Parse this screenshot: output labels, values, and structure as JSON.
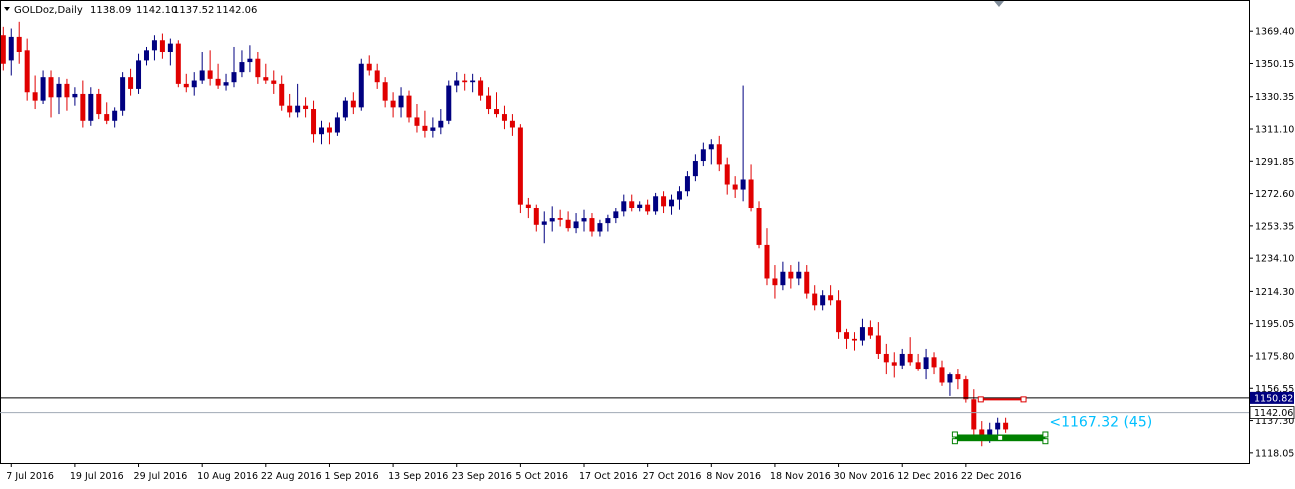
{
  "chart_data": {
    "type": "candlestick",
    "title": "GOLDoz,Daily",
    "ohlc_readout": [
      "1138.09",
      "1142.10",
      "1137.52",
      "1142.06"
    ],
    "ylim": [
      1112,
      1388
    ],
    "y_ticks": [
      "1369.40",
      "1350.15",
      "1330.35",
      "1311.10",
      "1291.85",
      "1272.60",
      "1253.35",
      "1234.10",
      "1214.30",
      "1195.05",
      "1175.80",
      "1156.55",
      "1137.30",
      "1118.05"
    ],
    "x_labels": [
      "7 Jul 2016",
      "19 Jul 2016",
      "29 Jul 2016",
      "10 Aug 2016",
      "22 Aug 2016",
      "1 Sep 2016",
      "13 Sep 2016",
      "23 Sep 2016",
      "5 Oct 2016",
      "17 Oct 2016",
      "27 Oct 2016",
      "8 Nov 2016",
      "18 Nov 2016",
      "30 Nov 2016",
      "12 Dec 2016",
      "22 Dec 2016"
    ],
    "x_label_bar_index": [
      1,
      9,
      17,
      25,
      33,
      41,
      49,
      57,
      65,
      73,
      81,
      89,
      97,
      105,
      113,
      121
    ],
    "candles": [
      [
        1367,
        1372,
        1346,
        1350
      ],
      [
        1352,
        1371,
        1343,
        1366
      ],
      [
        1366,
        1375,
        1350,
        1357
      ],
      [
        1358,
        1365,
        1328,
        1333
      ],
      [
        1333,
        1343,
        1323,
        1328
      ],
      [
        1328,
        1346,
        1326,
        1342
      ],
      [
        1342,
        1346,
        1318,
        1330
      ],
      [
        1330,
        1342,
        1320,
        1338
      ],
      [
        1338,
        1341,
        1322,
        1330
      ],
      [
        1330,
        1336,
        1325,
        1332
      ],
      [
        1332,
        1340,
        1312,
        1316
      ],
      [
        1316,
        1336,
        1313,
        1332
      ],
      [
        1332,
        1335,
        1317,
        1320
      ],
      [
        1320,
        1327,
        1314,
        1316
      ],
      [
        1316,
        1324,
        1312,
        1322
      ],
      [
        1322,
        1345,
        1319,
        1342
      ],
      [
        1342,
        1347,
        1331,
        1335
      ],
      [
        1335,
        1356,
        1332,
        1352
      ],
      [
        1352,
        1360,
        1349,
        1358
      ],
      [
        1358,
        1367,
        1352,
        1364
      ],
      [
        1364,
        1368,
        1353,
        1357
      ],
      [
        1357,
        1365,
        1349,
        1362
      ],
      [
        1362,
        1364,
        1336,
        1338
      ],
      [
        1338,
        1344,
        1333,
        1336
      ],
      [
        1336,
        1345,
        1331,
        1340
      ],
      [
        1340,
        1357,
        1338,
        1346
      ],
      [
        1346,
        1358,
        1337,
        1341
      ],
      [
        1341,
        1350,
        1335,
        1337
      ],
      [
        1337,
        1344,
        1334,
        1339
      ],
      [
        1339,
        1360,
        1336,
        1345
      ],
      [
        1345,
        1358,
        1342,
        1351
      ],
      [
        1351,
        1361,
        1345,
        1353
      ],
      [
        1353,
        1357,
        1338,
        1342
      ],
      [
        1342,
        1350,
        1338,
        1340
      ],
      [
        1340,
        1346,
        1332,
        1338
      ],
      [
        1338,
        1343,
        1322,
        1325
      ],
      [
        1325,
        1332,
        1318,
        1321
      ],
      [
        1321,
        1338,
        1318,
        1325
      ],
      [
        1325,
        1330,
        1318,
        1323
      ],
      [
        1323,
        1328,
        1303,
        1308
      ],
      [
        1308,
        1316,
        1302,
        1312
      ],
      [
        1312,
        1315,
        1302,
        1309
      ],
      [
        1309,
        1321,
        1307,
        1318
      ],
      [
        1318,
        1330,
        1316,
        1328
      ],
      [
        1328,
        1333,
        1320,
        1324
      ],
      [
        1324,
        1353,
        1322,
        1350
      ],
      [
        1350,
        1355,
        1343,
        1346
      ],
      [
        1346,
        1350,
        1335,
        1339
      ],
      [
        1339,
        1342,
        1324,
        1328
      ],
      [
        1328,
        1333,
        1318,
        1324
      ],
      [
        1324,
        1336,
        1318,
        1331
      ],
      [
        1331,
        1334,
        1315,
        1318
      ],
      [
        1318,
        1326,
        1309,
        1313
      ],
      [
        1313,
        1322,
        1306,
        1310
      ],
      [
        1310,
        1318,
        1306,
        1312
      ],
      [
        1312,
        1323,
        1308,
        1316
      ],
      [
        1316,
        1340,
        1314,
        1337
      ],
      [
        1337,
        1345,
        1333,
        1340
      ],
      [
        1340,
        1344,
        1334,
        1339
      ],
      [
        1339,
        1344,
        1333,
        1340
      ],
      [
        1340,
        1342,
        1328,
        1331
      ],
      [
        1331,
        1336,
        1320,
        1323
      ],
      [
        1323,
        1333,
        1318,
        1320
      ],
      [
        1320,
        1325,
        1311,
        1316
      ],
      [
        1316,
        1320,
        1307,
        1312
      ],
      [
        1312,
        1314,
        1261,
        1266
      ],
      [
        1266,
        1270,
        1258,
        1264
      ],
      [
        1264,
        1266,
        1250,
        1254
      ],
      [
        1254,
        1262,
        1243,
        1256
      ],
      [
        1256,
        1265,
        1250,
        1258
      ],
      [
        1258,
        1263,
        1253,
        1257
      ],
      [
        1257,
        1262,
        1250,
        1252
      ],
      [
        1252,
        1261,
        1249,
        1256
      ],
      [
        1256,
        1263,
        1250,
        1258
      ],
      [
        1258,
        1261,
        1247,
        1250
      ],
      [
        1250,
        1257,
        1247,
        1255
      ],
      [
        1255,
        1260,
        1250,
        1258
      ],
      [
        1258,
        1264,
        1255,
        1262
      ],
      [
        1262,
        1272,
        1259,
        1268
      ],
      [
        1268,
        1272,
        1262,
        1264
      ],
      [
        1264,
        1268,
        1262,
        1266
      ],
      [
        1266,
        1269,
        1260,
        1262
      ],
      [
        1262,
        1273,
        1260,
        1271
      ],
      [
        1271,
        1274,
        1261,
        1265
      ],
      [
        1265,
        1272,
        1260,
        1269
      ],
      [
        1269,
        1277,
        1263,
        1274
      ],
      [
        1274,
        1286,
        1271,
        1283
      ],
      [
        1283,
        1296,
        1280,
        1292
      ],
      [
        1292,
        1303,
        1289,
        1299
      ],
      [
        1299,
        1305,
        1290,
        1302
      ],
      [
        1302,
        1307,
        1286,
        1290
      ],
      [
        1290,
        1294,
        1272,
        1278
      ],
      [
        1278,
        1283,
        1270,
        1275
      ],
      [
        1275,
        1337,
        1268,
        1281
      ],
      [
        1281,
        1290,
        1262,
        1264
      ],
      [
        1264,
        1268,
        1240,
        1242
      ],
      [
        1242,
        1252,
        1218,
        1222
      ],
      [
        1222,
        1230,
        1210,
        1218
      ],
      [
        1218,
        1232,
        1215,
        1226
      ],
      [
        1226,
        1230,
        1216,
        1222
      ],
      [
        1222,
        1232,
        1218,
        1226
      ],
      [
        1226,
        1230,
        1210,
        1213
      ],
      [
        1213,
        1218,
        1203,
        1206
      ],
      [
        1206,
        1215,
        1203,
        1212
      ],
      [
        1212,
        1218,
        1206,
        1209
      ],
      [
        1209,
        1215,
        1186,
        1190
      ],
      [
        1190,
        1192,
        1180,
        1186
      ],
      [
        1186,
        1190,
        1179,
        1185
      ],
      [
        1185,
        1198,
        1182,
        1193
      ],
      [
        1193,
        1197,
        1186,
        1188
      ],
      [
        1188,
        1196,
        1174,
        1177
      ],
      [
        1177,
        1183,
        1165,
        1172
      ],
      [
        1172,
        1178,
        1163,
        1170
      ],
      [
        1170,
        1180,
        1168,
        1177
      ],
      [
        1177,
        1187,
        1170,
        1172
      ],
      [
        1172,
        1177,
        1167,
        1168
      ],
      [
        1168,
        1180,
        1162,
        1175
      ],
      [
        1175,
        1178,
        1165,
        1169
      ],
      [
        1169,
        1173,
        1158,
        1160
      ],
      [
        1160,
        1166,
        1152,
        1165
      ],
      [
        1165,
        1168,
        1156,
        1162
      ],
      [
        1162,
        1164,
        1148,
        1150
      ],
      [
        1150,
        1156,
        1128,
        1132
      ],
      [
        1132,
        1137,
        1122,
        1126
      ],
      [
        1126,
        1136,
        1124,
        1132
      ],
      [
        1132,
        1139,
        1128,
        1136
      ],
      [
        1136,
        1139,
        1130,
        1132
      ]
    ],
    "current_price_tag": "1142.06",
    "level_tag": "1150.82",
    "level_price": 1150.82,
    "current_price": 1142.06,
    "annotation": "<1167.32 (45)",
    "box_low": [
      1125,
      1129
    ],
    "bull_color": "#000080",
    "bear_color": "#e00000",
    "annotation_color": "#00bfff",
    "level_color": "#000000",
    "box_color": "#008000"
  }
}
